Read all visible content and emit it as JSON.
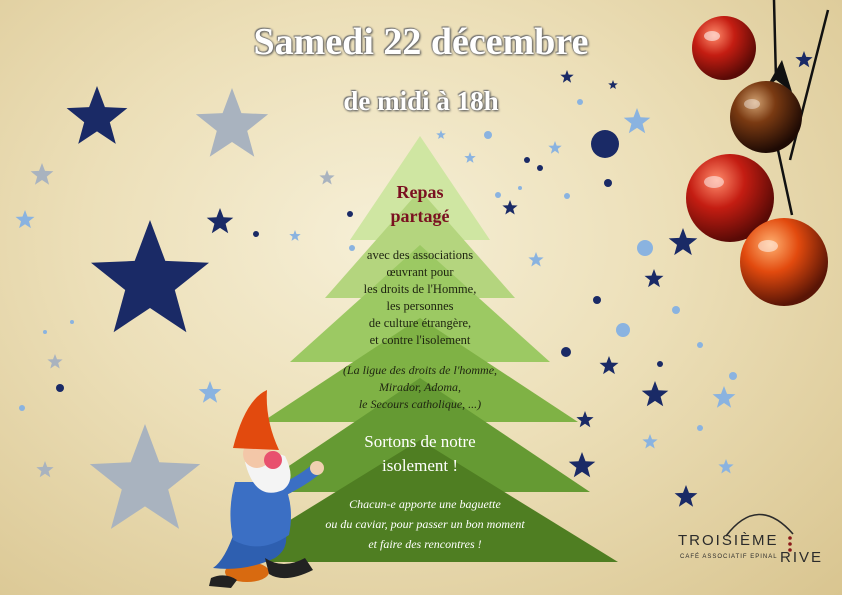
{
  "event": {
    "title": "Samedi 22 décembre",
    "subtitle": "de midi à 18h"
  },
  "tree": {
    "heading_line1": "Repas",
    "heading_line2": "partagé",
    "associations": [
      "avec des associations",
      "œuvrant pour",
      "les droits de l'Homme,",
      "les personnes",
      "de culture étrangère,",
      "et contre l'isolement"
    ],
    "partners": [
      "(La ligue des droits de l'homme,",
      "Mirador, Adoma,",
      "le Secours catholique, ...)"
    ],
    "slogan": [
      "Sortons de notre",
      "isolement !"
    ],
    "invite": [
      "Chacun-e apporte une baguette",
      "ou du caviar, pour passer un bon moment",
      "et faire des rencontres !"
    ]
  },
  "logo": {
    "word1": "TROISIÈME",
    "word2": "RIVE",
    "tagline": "CAFÉ ASSOCIATIF EPINAL"
  },
  "colors": {
    "tree_top": "#c9e39a",
    "tree_mid": "#8dbd4e",
    "tree_bottom": "#4f7e22",
    "heading": "#7a1020",
    "star_navy": "#1a2a66",
    "star_blue": "#2f56c9",
    "star_light": "#8ab3e0",
    "star_grey": "#a9b3bf",
    "ornament_red": "#c41d12",
    "ornament_orange": "#e24a0e",
    "ornament_dark": "#4a1a0e"
  },
  "decor": {
    "icons": [
      "star-icon",
      "ornament-icon",
      "gnome-figure",
      "christmas-tree-icon"
    ]
  }
}
